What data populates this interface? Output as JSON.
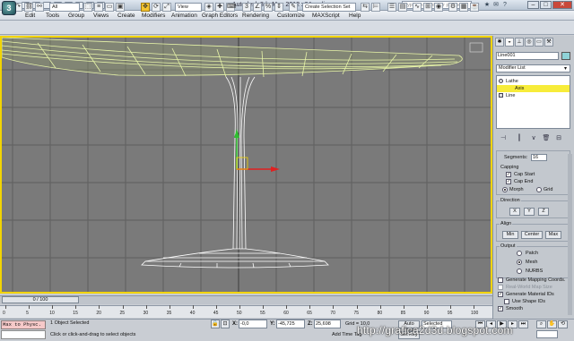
{
  "window": {
    "title": "Autodesk 3ds Max  2012 x64     sedia.max",
    "help_search_placeholder": "Type a keyword or phrase"
  },
  "menubar": {
    "items": [
      "Edit",
      "Tools",
      "Group",
      "Views",
      "Create",
      "Modifiers",
      "Animation",
      "Graph Editors",
      "Rendering",
      "Customize",
      "MAXScript",
      "Help"
    ]
  },
  "toolbar": {
    "filter_combo": "All",
    "reference_combo": "View",
    "selection_set_placeholder": "Create Selection Set"
  },
  "command_panel": {
    "object_name": "Line001",
    "object_color": "#8fd3d8",
    "modifier_list_label": "Modifier List",
    "stack": [
      {
        "label": "Lathe",
        "level": 0,
        "selected": false
      },
      {
        "label": "Axis",
        "level": 1,
        "selected": true
      },
      {
        "label": "Line",
        "level": 0,
        "selected": false
      }
    ],
    "segments_label": "Segments:",
    "segments_value": "16",
    "capping": {
      "title": "Capping",
      "cap_start": "Cap Start",
      "cap_end": "Cap End",
      "morph": "Morph",
      "grid": "Grid"
    },
    "direction": {
      "title": "Direction",
      "x": "X",
      "y": "Y",
      "z": "Z"
    },
    "align": {
      "title": "Align",
      "min": "Min",
      "center": "Center",
      "max": "Max"
    },
    "output": {
      "title": "Output",
      "patch": "Patch",
      "mesh": "Mesh",
      "nurbs": "NURBS",
      "generate_mapping": "Generate Mapping Coords.",
      "real_world_map": "Real-World Map Size",
      "generate_material_ids": "Generate Material IDs",
      "use_shape_ids": "Use Shape IDs",
      "smooth": "Smooth"
    }
  },
  "timeline": {
    "slider_label": "0 / 100",
    "ticks": [
      "0",
      "5",
      "10",
      "15",
      "20",
      "25",
      "30",
      "35",
      "40",
      "45",
      "50",
      "55",
      "60",
      "65",
      "70",
      "75",
      "80",
      "85",
      "90",
      "95",
      "100"
    ]
  },
  "status": {
    "maxscript": "Max to Physc.",
    "selected": "1 Object Selected",
    "prompt": "Click or click-and-drag to select objects",
    "x_label": "X:",
    "x_value": "-0,0",
    "y_label": "Y:",
    "y_value": "-45,725",
    "z_label": "Z:",
    "z_value": "25,698",
    "grid": "Grid = 10,0",
    "add_time_tag": "Add Time Tag",
    "auto_key": "Auto Key",
    "set_key": "Set Key",
    "key_filter": "Selected"
  },
  "watermark": "http://grafica2d3d.blogspot.com",
  "colors": {
    "viewport_bg": "#7a7a7a",
    "viewport_border": "#f2d400",
    "selection_highlight": "#f7ec3a"
  }
}
